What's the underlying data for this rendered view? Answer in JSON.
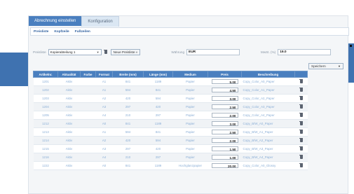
{
  "tabs": [
    "Abrechnung einstellen",
    "Konfiguration"
  ],
  "subnav": [
    "Preisliste",
    "Kopfzeile",
    "Fußzeilen"
  ],
  "toolbar": {
    "preisliste_label": "Preisliste",
    "preisliste_value": "Kopierabteilung 1",
    "new_button": "Neue Preisliste »",
    "waehrung_label": "Währung",
    "waehrung_value": "EUR",
    "mwst_label": "MwSt. (%)",
    "mwst_value": "19.0",
    "save_label": "Speichern"
  },
  "table": {
    "headers": [
      "Artikelnr.",
      "Aktualität",
      "Farbe",
      "Format",
      "Breite (mm)",
      "Länge (mm)",
      "Medium",
      "Preis",
      "Beschreibung",
      ""
    ],
    "rows": [
      {
        "nr": "1201",
        "akt": "Aktiv",
        "farbe": "",
        "format": "A1",
        "breite": "841",
        "laenge": "1189",
        "medium": "Papier",
        "preis": "5.00",
        "desc": "Copy_Color_A0_Paper"
      },
      {
        "nr": "1202",
        "akt": "Aktiv",
        "farbe": "",
        "format": "A1",
        "breite": "594",
        "laenge": "841",
        "medium": "Papier",
        "preis": "4.50",
        "desc": "Copy_Color_A1_Paper"
      },
      {
        "nr": "1203",
        "akt": "Aktiv",
        "farbe": "",
        "format": "A2",
        "breite": "420",
        "laenge": "594",
        "medium": "Papier",
        "preis": "3.00",
        "desc": "Copy_Color_A2_Paper"
      },
      {
        "nr": "1204",
        "akt": "Aktiv",
        "farbe": "",
        "format": "A3",
        "breite": "297",
        "laenge": "420",
        "medium": "Papier",
        "preis": "2.50",
        "desc": "Copy_Color_A3_Paper"
      },
      {
        "nr": "1205",
        "akt": "Aktiv",
        "farbe": "",
        "format": "A4",
        "breite": "210",
        "laenge": "297",
        "medium": "Papier",
        "preis": "2.00",
        "desc": "Copy_Color_A4_Paper"
      },
      {
        "nr": "1212",
        "akt": "Aktiv",
        "farbe": "",
        "format": "A0",
        "breite": "841",
        "laenge": "1189",
        "medium": "Papier",
        "preis": "3.00",
        "desc": "Copy_B/W_A0_Paper"
      },
      {
        "nr": "1213",
        "akt": "Aktiv",
        "farbe": "",
        "format": "A1",
        "breite": "594",
        "laenge": "841",
        "medium": "Papier",
        "preis": "2.50",
        "desc": "Copy_B/W_A1_Paper"
      },
      {
        "nr": "1214",
        "akt": "Aktiv",
        "farbe": "",
        "format": "A2",
        "breite": "420",
        "laenge": "594",
        "medium": "Papier",
        "preis": "2.00",
        "desc": "Copy_B/W_A2_Paper"
      },
      {
        "nr": "1215",
        "akt": "Aktiv",
        "farbe": "",
        "format": "A3",
        "breite": "297",
        "laenge": "420",
        "medium": "Papier",
        "preis": "1.50",
        "desc": "Copy_B/W_A3_Paper"
      },
      {
        "nr": "1216",
        "akt": "Aktiv",
        "farbe": "",
        "format": "A4",
        "breite": "210",
        "laenge": "297",
        "medium": "Papier",
        "preis": "1.00",
        "desc": "Copy_B/W_A4_Paper"
      },
      {
        "nr": "1222",
        "akt": "Aktiv",
        "farbe": "",
        "format": "A0",
        "breite": "841",
        "laenge": "1189",
        "medium": "Hochglanzpapier",
        "preis": "20.00",
        "desc": "Copy_Color_A0_Glossy"
      }
    ]
  },
  "colors": {
    "accent": "#4a7fbf",
    "band": "#3f72b0"
  },
  "icons": {
    "delete": "trash-icon",
    "dropdown": "chevron-down-icon"
  }
}
